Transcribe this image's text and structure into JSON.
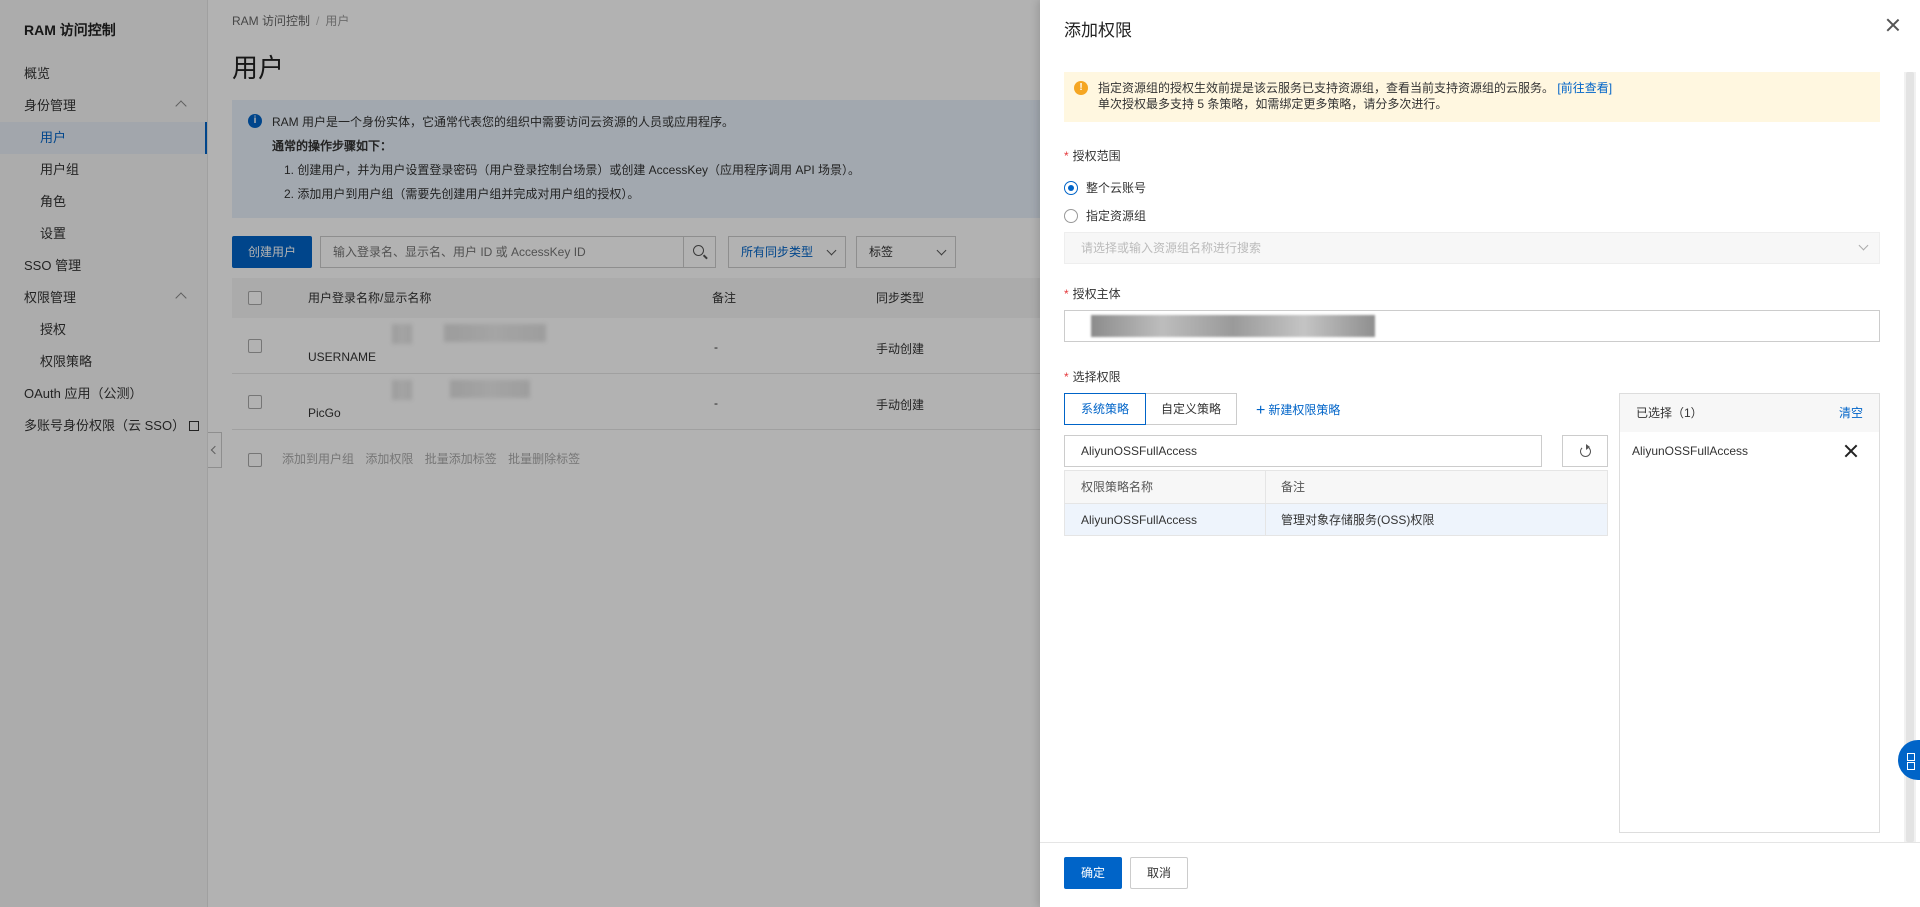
{
  "sidebar": {
    "title": "RAM 访问控制",
    "items": [
      {
        "label": "概览"
      },
      {
        "label": "身份管理"
      },
      {
        "label": "用户"
      },
      {
        "label": "用户组"
      },
      {
        "label": "角色"
      },
      {
        "label": "设置"
      },
      {
        "label": "SSO 管理"
      },
      {
        "label": "权限管理"
      },
      {
        "label": "授权"
      },
      {
        "label": "权限策略"
      },
      {
        "label": "OAuth 应用（公测）"
      },
      {
        "label": "多账号身份权限（云 SSO）"
      }
    ]
  },
  "main": {
    "breadcrumb": [
      "RAM 访问控制",
      "用户"
    ],
    "title": "用户",
    "info": {
      "line1": "RAM 用户是一个身份实体，它通常代表您的组织中需要访问云资源的人员或应用程序。",
      "line2": "通常的操作步骤如下：",
      "line3": "1. 创建用户，并为用户设置登录密码（用户登录控制台场景）或创建 AccessKey（应用程序调用 API 场景）。",
      "line4": "2. 添加用户到用户组（需要先创建用户组并完成对用户组的授权）。"
    },
    "toolbar": {
      "create_label": "创建用户",
      "search_placeholder": "输入登录名、显示名、用户 ID 或 AccessKey ID",
      "sync_type": "所有同步类型",
      "tag": "标签"
    },
    "table": {
      "headers": [
        "用户登录名称/显示名称",
        "备注",
        "同步类型"
      ],
      "rows": [
        {
          "name": "USERNAME",
          "note": "-",
          "sync": "手动创建"
        },
        {
          "name": "PicGo",
          "note": "-",
          "sync": "手动创建"
        }
      ]
    },
    "batch_actions": [
      "添加到用户组",
      "添加权限",
      "批量添加标签",
      "批量删除标签"
    ]
  },
  "drawer": {
    "title": "添加权限",
    "warning": {
      "text1": "指定资源组的授权生效前提是该云服务已支持资源组，查看当前支持资源组的云服务。",
      "link": "[前往查看]",
      "text2": "单次授权最多支持 5 条策略，如需绑定更多策略，请分多次进行。"
    },
    "scope": {
      "label": "授权范围",
      "options": [
        "整个云账号",
        "指定资源组"
      ],
      "selected": "整个云账号",
      "rg_placeholder": "请选择或输入资源组名称进行搜索"
    },
    "principal": {
      "label": "授权主体"
    },
    "permissions": {
      "label": "选择权限",
      "tabs": [
        "系统策略",
        "自定义策略"
      ],
      "active_tab": "系统策略",
      "new_policy": "新建权限策略",
      "search_value": "AliyunOSSFullAccess",
      "table_headers": [
        "权限策略名称",
        "备注"
      ],
      "rows": [
        {
          "name": "AliyunOSSFullAccess",
          "note": "管理对象存储服务(OSS)权限"
        }
      ],
      "selected_title": "已选择（1）",
      "clear": "清空",
      "selected_items": [
        "AliyunOSSFullAccess"
      ]
    },
    "footer": {
      "ok": "确定",
      "cancel": "取消"
    }
  },
  "colors": {
    "accent": "#0064c8",
    "warning_bg": "#fff7e0",
    "info_bg": "#e8f1fb"
  }
}
